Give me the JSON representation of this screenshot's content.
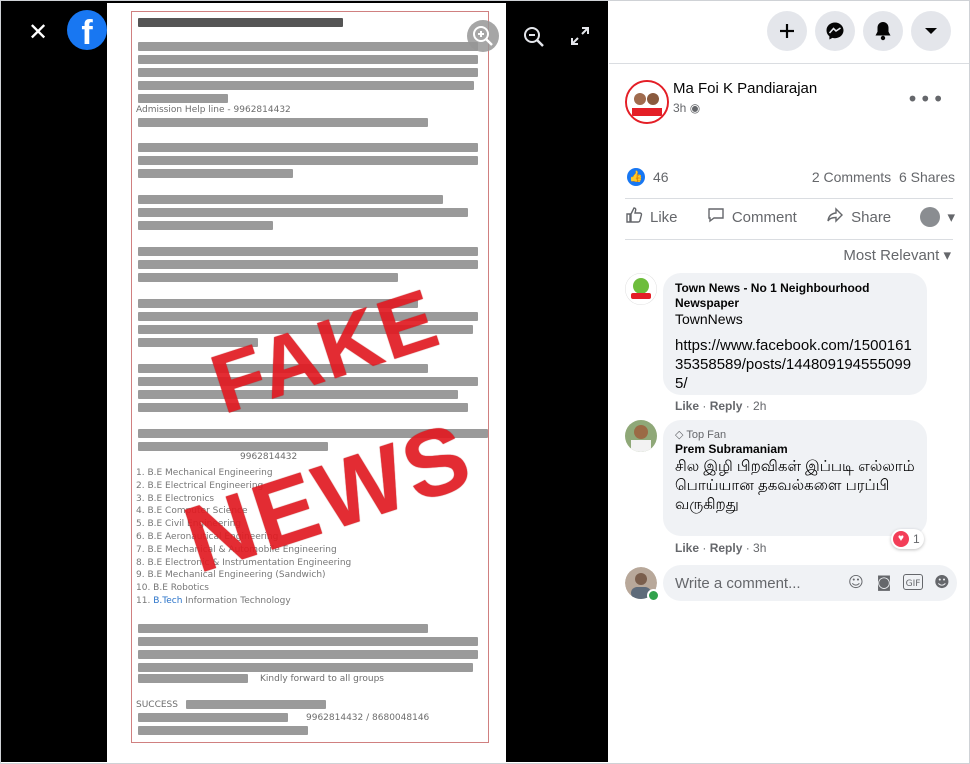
{
  "viewer": {
    "close_icon": "close-icon",
    "logo": "facebook-logo",
    "logo_letter": "f",
    "zoom_in_icon": "zoom-in-icon",
    "zoom_out_icon": "zoom-out-icon",
    "fullscreen_icon": "fullscreen-icon"
  },
  "photo": {
    "stamp_line1": "FAKE",
    "stamp_line2": "NEWS",
    "help_line": "Admission Help line - 9962814432",
    "contact": "9962814432",
    "list": [
      "1. B.E Mechanical Engineering",
      "2. B.E Electrical Engineering",
      "3. B.E Electronics",
      "4. B.E Computer Science",
      "5. B.E Civil Engineering",
      "6. B.E Aeronautical Engineering",
      "7. B.E Mechanical & Automobile Engineering",
      "8. B.E Electronic & Instrumentation Engineering",
      "9. B.E Mechanical Engineering (Sandwich)",
      "10. B.E Robotics"
    ],
    "list_last_num": "11.",
    "list_last_btech": "B.Tech",
    "list_last_rest": "Information Technology",
    "kindly": "Kindly forward to all groups",
    "success": "SUCCESS",
    "phones": "9962814432 / 8680048146"
  },
  "header_icons": [
    "plus-icon",
    "messenger-icon",
    "bell-icon",
    "caret-down-icon"
  ],
  "post": {
    "author": "Ma Foi K Pandiarajan",
    "time": "3h",
    "likes": "46",
    "comments": "2 Comments",
    "shares": "6 Shares",
    "actions": {
      "like": "Like",
      "comment": "Comment",
      "share": "Share"
    },
    "sort": "Most Relevant"
  },
  "comments": [
    {
      "author": "Town News - No 1 Neighbourhood Newspaper",
      "sub": "TownNews",
      "text": "https://www.facebook.com/150016135358589/posts/1448091945550995/",
      "like": "Like",
      "reply": "Reply",
      "time": "2h"
    },
    {
      "badge": "Top Fan",
      "author": "Prem Subramaniam",
      "text": "சில இழி பிறவிகள் இப்படி எல்லாம் பொய்யான தகவல்களை பரப்பி வருகிறது",
      "like": "Like",
      "reply": "Reply",
      "time": "3h",
      "reactions": "1"
    }
  ],
  "composer": {
    "placeholder": "Write a comment..."
  }
}
